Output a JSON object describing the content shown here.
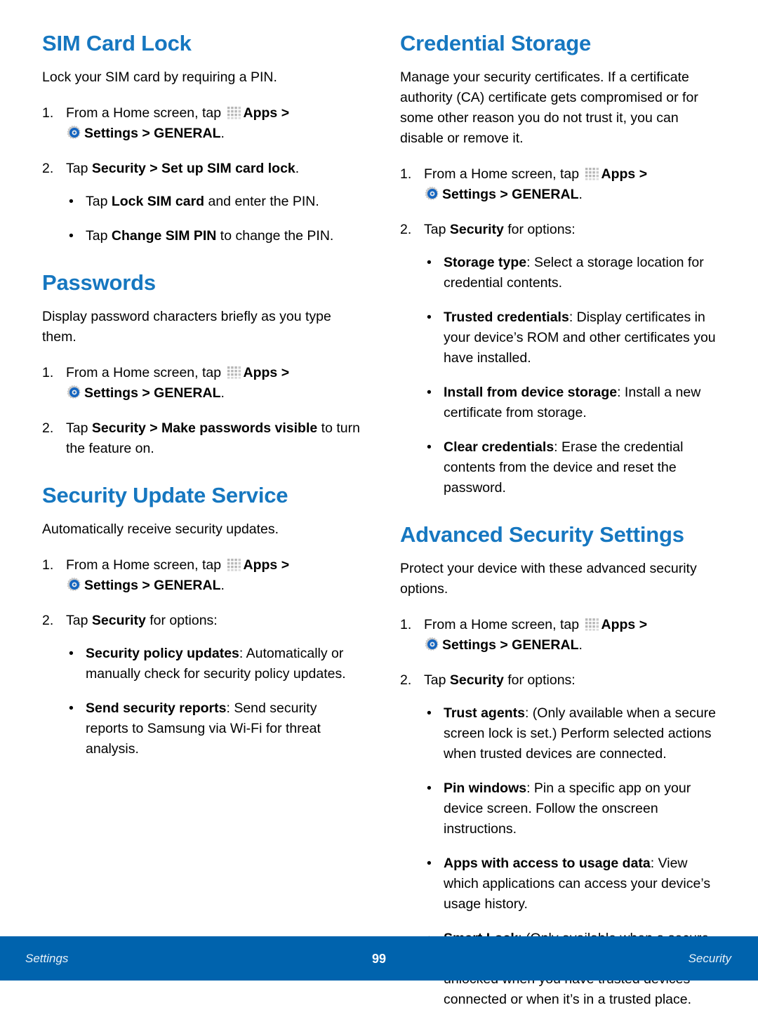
{
  "page": {
    "number": "99",
    "footer_left": "Settings",
    "footer_right": "Security",
    "accent_heading_color": "#1677c0",
    "footer_bar_color": "#0063ad"
  },
  "icons": {
    "apps": "apps-grid-icon",
    "settings": "settings-gear-icon"
  },
  "left_column": {
    "sections": [
      {
        "title": "SIM Card Lock",
        "intro": "Lock your SIM card by requiring a PIN.",
        "step1": {
          "num": "1.",
          "text_a": "From a Home screen, tap",
          "apps_label": "Apps",
          "gt1": ">",
          "settings_label": "Settings",
          "gt2": ">",
          "general_label": "GENERAL",
          "period": "."
        },
        "step2": {
          "num": "2.",
          "lead": "Tap",
          "bold_a": "Security > Set up SIM card lock",
          "tail": "."
        },
        "bullets": [
          {
            "lead": "Tap ",
            "bold": "Lock SIM card",
            "tail": " and enter the PIN."
          },
          {
            "lead": "Tap ",
            "bold": "Change SIM PIN",
            "tail": " to change the PIN."
          }
        ]
      },
      {
        "title": "Passwords",
        "intro": "Display password characters briefly as you type them.",
        "step1": {
          "num": "1.",
          "text_a": "From a Home screen, tap",
          "apps_label": "Apps",
          "gt1": ">",
          "settings_label": "Settings",
          "gt2": ">",
          "general_label": "GENERAL",
          "period": "."
        },
        "step2": {
          "num": "2.",
          "lead": "Tap",
          "bold_a": "Security > Make passwords visible",
          "tail": " to turn the feature on."
        },
        "bullets": []
      },
      {
        "title": "Security Update Service",
        "intro": "Automatically receive security updates.",
        "step1": {
          "num": "1.",
          "text_a": "From a Home screen, tap",
          "apps_label": "Apps",
          "gt1": ">",
          "settings_label": "Settings",
          "gt2": ">",
          "general_label": "GENERAL",
          "period": "."
        },
        "step2": {
          "num": "2.",
          "lead": "Tap",
          "bold_a": "Security",
          "tail": " for options:"
        },
        "bullets": [
          {
            "lead": "",
            "bold": "Security policy updates",
            "tail": ": Automatically or manually check for security policy updates."
          },
          {
            "lead": "",
            "bold": "Send security reports",
            "tail": ": Send security reports to Samsung via Wi-Fi for threat analysis."
          }
        ]
      }
    ]
  },
  "right_column": {
    "sections": [
      {
        "title": "Credential Storage",
        "intro": "Manage your security certificates. If a certificate authority (CA) certificate gets compromised or for some other reason you do not trust it, you can disable or remove it.",
        "step1": {
          "num": "1.",
          "text_a": "From a Home screen, tap",
          "apps_label": "Apps",
          "gt1": ">",
          "settings_label": "Settings",
          "gt2": ">",
          "general_label": "GENERAL",
          "period": "."
        },
        "step2": {
          "num": "2.",
          "lead": "Tap",
          "bold_a": "Security",
          "tail": " for options:"
        },
        "bullets": [
          {
            "lead": "",
            "bold": "Storage type",
            "tail": ": Select a storage location for credential contents."
          },
          {
            "lead": "",
            "bold": "Trusted credentials",
            "tail": ": Display certificates in your device’s ROM and other certificates you have installed."
          },
          {
            "lead": "",
            "bold": "Install from device storage",
            "tail": ": Install a new certificate from storage."
          },
          {
            "lead": "",
            "bold": "Clear credentials",
            "tail": ": Erase the credential contents from the device and reset the password."
          }
        ]
      },
      {
        "title": "Advanced Security Settings",
        "intro": "Protect your device with these advanced security options.",
        "step1": {
          "num": "1.",
          "text_a": "From a Home screen, tap",
          "apps_label": "Apps",
          "gt1": ">",
          "settings_label": "Settings",
          "gt2": ">",
          "general_label": "GENERAL",
          "period": "."
        },
        "step2": {
          "num": "2.",
          "lead": "Tap",
          "bold_a": "Security",
          "tail": " for options:"
        },
        "bullets": [
          {
            "lead": "",
            "bold": "Trust agents",
            "tail": ": (Only available when a secure screen lock is set.) Perform selected actions when trusted devices are connected."
          },
          {
            "lead": "",
            "bold": "Pin windows",
            "tail": ": Pin a specific app on your device screen. Follow the onscreen instructions."
          },
          {
            "lead": "",
            "bold": "Apps with access to usage data",
            "tail": ": View which applications can access your device’s usage history."
          },
          {
            "lead": "",
            "bold": "Smart Lock",
            "tail": ": (Only available when a secure screen lock is set.) Set your device to stay unlocked when you have trusted devices connected or when it’s in a trusted place."
          }
        ]
      }
    ]
  }
}
